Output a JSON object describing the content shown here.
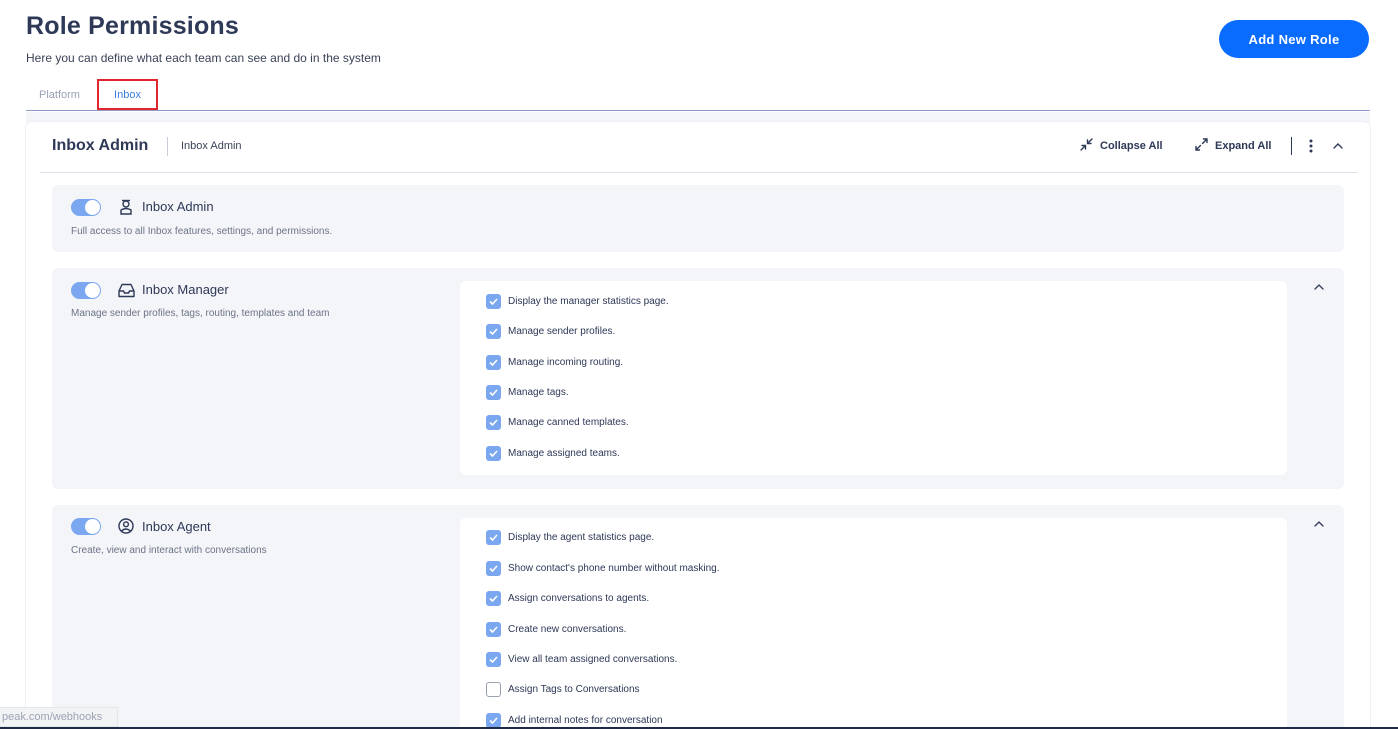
{
  "header": {
    "title": "Role Permissions",
    "subtitle": "Here you can define what each team can see and do in the system",
    "add_button": "Add New Role"
  },
  "tabs": [
    {
      "label": "Platform",
      "active": false
    },
    {
      "label": "Inbox",
      "active": true
    }
  ],
  "card": {
    "title": "Inbox Admin",
    "subtitle": "Inbox Admin",
    "collapse_all": "Collapse All",
    "expand_all": "Expand All"
  },
  "sections": {
    "admin": {
      "title": "Inbox Admin",
      "description": "Full access to all Inbox features, settings, and permissions.",
      "enabled": true,
      "icon": "user-badge-icon"
    },
    "manager": {
      "title": "Inbox Manager",
      "description": "Manage sender profiles, tags, routing, templates and team",
      "enabled": true,
      "icon": "inbox-tray-icon",
      "permissions": [
        {
          "label": "Display the manager statistics page.",
          "checked": true
        },
        {
          "label": "Manage sender profiles.",
          "checked": true
        },
        {
          "label": "Manage incoming routing.",
          "checked": true
        },
        {
          "label": "Manage tags.",
          "checked": true
        },
        {
          "label": "Manage canned templates.",
          "checked": true
        },
        {
          "label": "Manage assigned teams.",
          "checked": true
        }
      ]
    },
    "agent": {
      "title": "Inbox Agent",
      "description": "Create, view and interact with conversations",
      "enabled": true,
      "icon": "user-circle-icon",
      "permissions": [
        {
          "label": "Display the agent statistics page.",
          "checked": true
        },
        {
          "label": "Show contact's phone number without masking.",
          "checked": true
        },
        {
          "label": "Assign conversations to agents.",
          "checked": true
        },
        {
          "label": "Create new conversations.",
          "checked": true
        },
        {
          "label": "View all team assigned conversations.",
          "checked": true
        },
        {
          "label": "Assign Tags to Conversations",
          "checked": false
        },
        {
          "label": "Add internal notes for conversation",
          "checked": true
        }
      ]
    }
  },
  "status_bar": {
    "url": "peak.com/webhooks"
  },
  "colors": {
    "accent": "#0a6bff",
    "toggle": "#7aa7f0",
    "highlight_border": "#e2262f"
  }
}
